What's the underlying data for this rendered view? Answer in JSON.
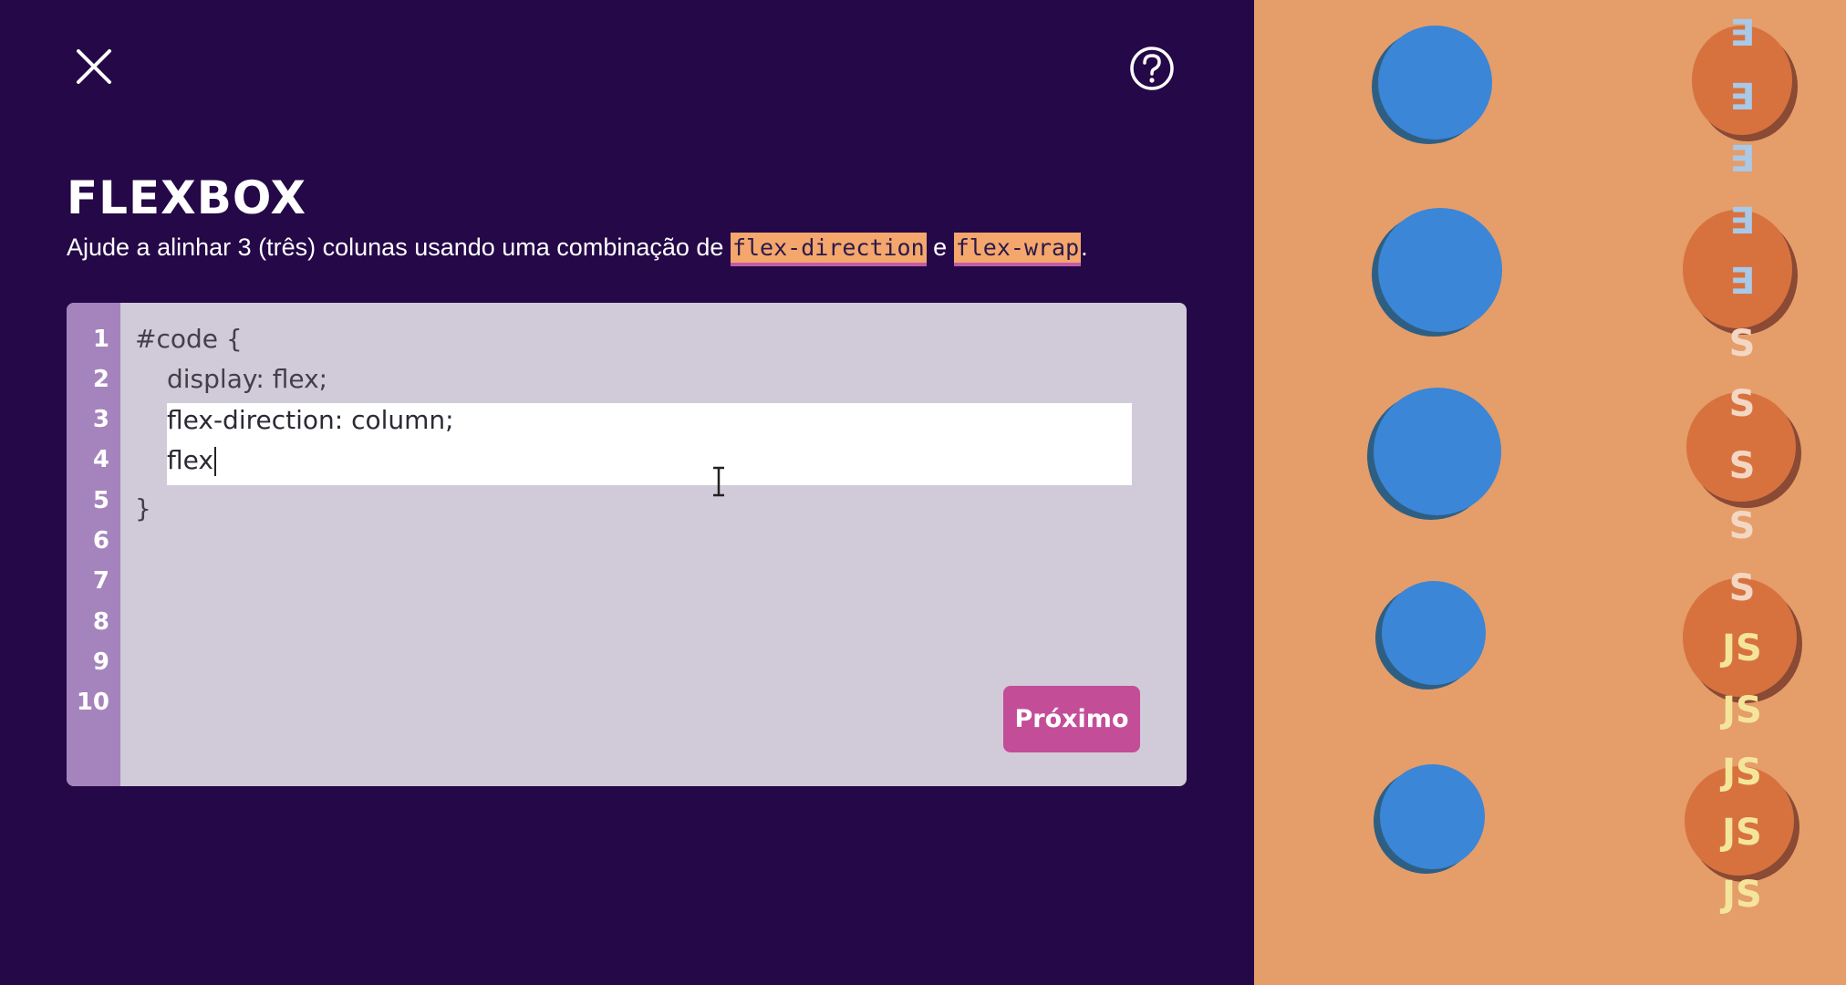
{
  "header": {
    "close_icon": "close-icon",
    "help_icon": "help-icon"
  },
  "level": {
    "title": "FLEXBOX",
    "instruction_prefix": "Ajude a alinhar 3 (três) colunas usando uma combinação de ",
    "code_tag_1": "flex-direction",
    "instruction_middle": " e ",
    "code_tag_2": "flex-wrap",
    "instruction_suffix": "."
  },
  "editor": {
    "line_numbers": [
      "1",
      "2",
      "3",
      "4",
      "5",
      "6",
      "7",
      "8",
      "9",
      "10"
    ],
    "line_1": "#code {",
    "line_2": "display: flex;",
    "input_line_1": "flex-direction: column;",
    "input_line_2": "flex",
    "line_5": "}",
    "next_label": "Próximo"
  },
  "board": {
    "pieces": [
      {
        "kind": "css3",
        "label": "∃"
      },
      {
        "kind": "html5",
        "label": "S"
      },
      {
        "kind": "js",
        "label": "JS"
      }
    ],
    "colors": {
      "blue_target": "#3b86d6",
      "orange_piece": "#d7723f",
      "board_background": "#e59d6a",
      "panel_background": "#250847"
    }
  }
}
